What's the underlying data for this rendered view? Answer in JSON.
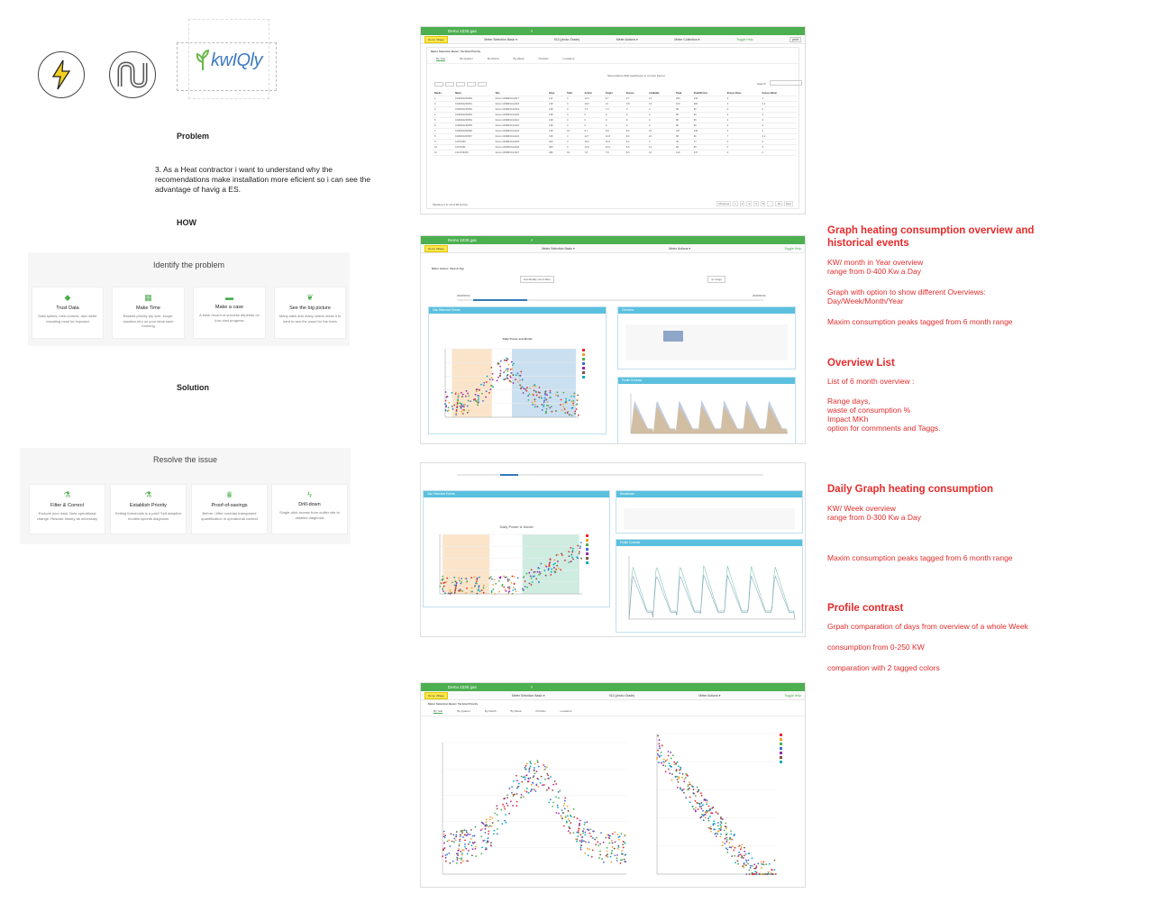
{
  "logos": {
    "lightning": "lightning-icon",
    "pipe": "pipe-icon",
    "brand": "kwIQly"
  },
  "problem": {
    "heading": "Problem",
    "statement": "3.  As a Heat contractor i want to understand why the recomendations make installation more eficient so  i can see the advantage of havig a ES."
  },
  "how": {
    "heading": "HOW"
  },
  "identify": {
    "title": "Identify the problem",
    "cards": [
      {
        "icon": "diamond-icon",
        "title": "Trust Data",
        "desc": "Data spikes, meri-comms, and meter rescaling must be exposed"
      },
      {
        "icon": "calendar-icon",
        "title": "Make Time",
        "desc": "Ranked priority (by size, scope, duration etc) on your desk each morning"
      },
      {
        "icon": "briefcase-icon",
        "title": "Make a case",
        "desc": "A track record of success depends on iron-clad progress"
      },
      {
        "icon": "leaf-icon",
        "title": "See the big picture",
        "desc": "Many sites and many charts mean it is hard to see the wood for the trees"
      }
    ]
  },
  "solution": {
    "heading": "Solution"
  },
  "resolve": {
    "title": "Resolve the issue",
    "cards": [
      {
        "icon": "flask-icon",
        "title": "Filter & Correct",
        "desc": "Exclude poor data. Note operational change. Rescale history as necessary"
      },
      {
        "icon": "flask-icon",
        "title": "Establish Priority",
        "desc": "Setting thresholds is a pain! Self adaptive models speeds diagnosis"
      },
      {
        "icon": "trophy-icon",
        "title": "Proof-of-savings",
        "desc": "Before / After contrast transparent quantification in operational context"
      },
      {
        "icon": "bolt-icon",
        "title": "Drill-down",
        "desc": "Single-click access from outlier site to detailed diagnosis"
      }
    ]
  },
  "screens": {
    "s1": {
      "tab": "Demo 1030 gas",
      "demo_button": "Demo Village",
      "menu1": "Meter Selection Basic ▾",
      "center_text": "913 (photo Grade)",
      "menu2": "Meter Actions ▾",
      "menu3": "Meter Collection ▾",
      "toggle": "Toggle Help",
      "print": "print",
      "panel_title": "Meter Selection Basic: Tactical Priority",
      "tabs": [
        "By Year",
        "By Quarter",
        "By Month",
        "By Week",
        "Portfolio",
        "Locations"
      ],
      "search_label": "Search:",
      "show_text": "Show Meters With Gas/Power in Current Period",
      "showing": "Showing 1 to 10 of 98 entries",
      "columns": [
        "Ranks",
        "Meter",
        "Site",
        "Days",
        "Start",
        "Actual",
        "Target",
        "Excess",
        "Available",
        "Peak",
        "Peak/Period",
        "Excess Days",
        "Excess Meter"
      ],
      "rows": [
        [
          "1",
          "1600001234560",
          "Demo 1039MSC12417",
          "134",
          "0",
          "12.5",
          "8.7",
          "3.7",
          "16",
          "200",
          "140",
          "0",
          "1"
        ],
        [
          "2",
          "1600001234561",
          "Demo 1039MSC12418",
          "138",
          "0",
          "10.9",
          "14",
          "0.8",
          "16",
          "100",
          "384",
          "0",
          "0.1"
        ],
        [
          "3",
          "1600001234562",
          "Demo 1039MSC12419",
          "138",
          "0",
          "7.3",
          "7.3",
          "0",
          "0",
          "80",
          "80",
          "0",
          "0"
        ],
        [
          "4",
          "1600001234563",
          "Demo 1039MSC12420",
          "138",
          "0",
          "0",
          "0",
          "0",
          "0",
          "80",
          "80",
          "0",
          "0"
        ],
        [
          "5",
          "1600001234564",
          "Demo 1039MSC12421",
          "138",
          "0",
          "0",
          "0",
          "0",
          "0",
          "80",
          "80",
          "0",
          "0"
        ],
        [
          "6",
          "1600001234565",
          "Demo 1039MSC12422",
          "138",
          "0",
          "0",
          "0",
          "0",
          "0",
          "80",
          "80",
          "0",
          "0"
        ],
        [
          "7",
          "1600001234566",
          "Demo 1039MSC12423",
          "138",
          "16",
          "9.7",
          "0.8",
          "8.3",
          "15",
          "237",
          "136",
          "0",
          "0"
        ],
        [
          "8",
          "1600001234567",
          "Demo 1039MSC12424",
          "138",
          "0",
          "12.7",
          "12.8",
          "8.0",
          "20",
          "80",
          "80",
          "7",
          "0.1"
        ],
        [
          "9",
          "12071060",
          "Demo 1039MSC12425",
          "300",
          "0",
          "16.6",
          "10.0",
          "6.2",
          "0",
          "40",
          "77",
          "0",
          "0"
        ],
        [
          "10",
          "12071061",
          "Demo 1039MSC12426",
          "300",
          "0",
          "12.6",
          "10.0",
          "6.5",
          "14",
          "80",
          "80",
          "0",
          "0"
        ],
        [
          "11",
          "1314733250",
          "Demo 1039MSC12427",
          "380",
          "19",
          "7.8",
          "7.8",
          "8.0",
          "16",
          "143",
          "137",
          "0",
          "0"
        ]
      ],
      "pager": [
        "Previous",
        "1",
        "2",
        "3",
        "4",
        "5",
        "…",
        "10",
        "Next"
      ]
    },
    "s2": {
      "tab": "Demo 1030 gas",
      "header_title": "Meter Action: View & Tag",
      "left_box": "Gas Historical Events",
      "chart_title": "Daily Power and Model",
      "right_box": "Overview",
      "profile_box": "Profile Contrast",
      "date_from": "2020/09/11",
      "date_to": "2020/09/11",
      "btn": "Get Modify xsmm filter",
      "btn2": "no range"
    },
    "s3": {
      "left_box": "Gas Historical Events",
      "chart_title": "Daily Power & Model",
      "right_box": "Breakdown",
      "profile_box": "Profile Contrast"
    },
    "s4": {
      "tab": "Demo 1030 gas",
      "demo_button": "Demo Village",
      "panel_title": "Meter Selection Basic: Tactical Priority",
      "tabs": [
        "By Year",
        "By Quarter",
        "By Month",
        "By Week",
        "Portfolio",
        "Locations"
      ]
    }
  },
  "notes": {
    "n1": {
      "heading": "Graph heating consumption overview and historical events",
      "lines": [
        "KW/ month  in  Year overview",
        "range from 0-400 Kw a Day",
        "Graph with option to show different Overviews: Day/Week/Month/Year",
        "Maxim consumption peaks tagged from 6 month range"
      ]
    },
    "n2": {
      "heading": "Overview List",
      "lines": [
        "List of 6 month overview :",
        "Range days,",
        "waste of consumption %",
        "Impact MKh",
        "option for commnents and Taggs."
      ]
    },
    "n3": {
      "heading": "Daily Graph heating consumption",
      "lines": [
        "KW/ Week overview",
        "range from 0-300 Kw a Day",
        "Maxim consumption peaks tagged from 6 month range"
      ]
    },
    "n4": {
      "heading": "Profile contrast",
      "lines": [
        "Grpah comparation of days from  overview of a whole Week",
        "consumption from 0-250 KW",
        "comparation with 2 tagged colors"
      ]
    }
  },
  "colors": {
    "green": "#4caf50",
    "red": "#e52b2b",
    "blue": "#5bc0de",
    "yellow": "#ffe84a"
  }
}
